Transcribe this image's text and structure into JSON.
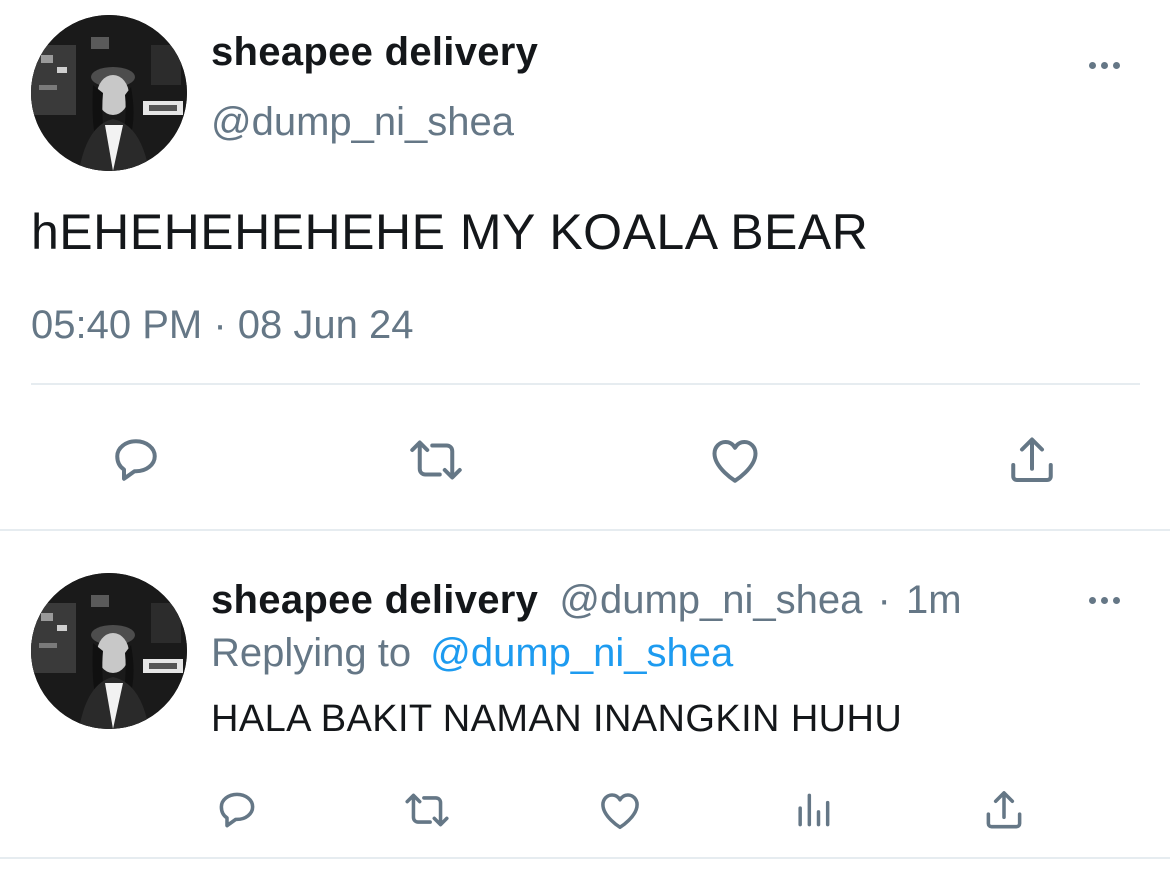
{
  "main_tweet": {
    "author_name": "sheapee delivery",
    "author_handle": "@dump_ni_shea",
    "text": "hEHEHEHEHEHE MY KOALA BEAR",
    "timestamp": "05:40 PM · 08 Jun 24",
    "actions": [
      "reply-icon",
      "retweet-icon",
      "like-icon",
      "share-icon"
    ]
  },
  "reply_tweet": {
    "author_name": "sheapee delivery",
    "author_handle": "@dump_ni_shea",
    "separator": "·",
    "time_ago": "1m",
    "replying_to_label": "Replying to",
    "replying_to_handle": "@dump_ni_shea",
    "text": "HALA BAKIT NAMAN INANGKIN HUHU",
    "actions": [
      "reply-icon",
      "retweet-icon",
      "like-icon",
      "analytics-icon",
      "share-icon"
    ]
  },
  "colors": {
    "text_primary": "#14171a",
    "text_secondary": "#657786",
    "link": "#1d9bf0",
    "divider": "#e6ecf0",
    "background": "#ffffff"
  }
}
